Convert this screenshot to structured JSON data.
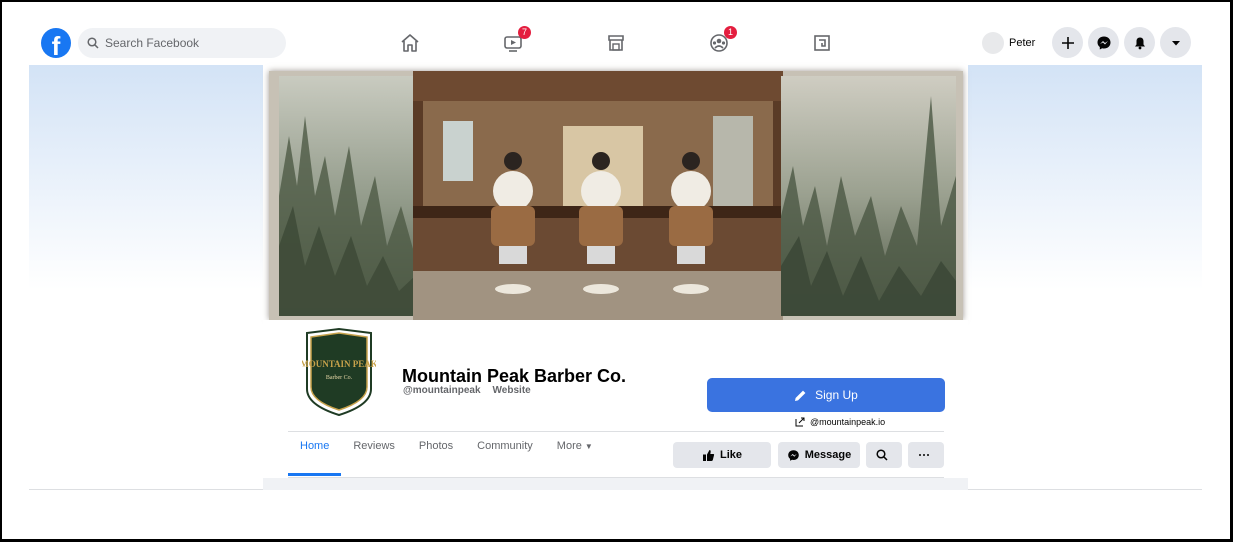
{
  "search": {
    "placeholder": "Search Facebook"
  },
  "nav": {
    "watch_badge": "7",
    "groups_badge": "1"
  },
  "user": {
    "name": "Peter"
  },
  "page": {
    "logo_text": "MOUNTAIN PEAK",
    "logo_subtext": "Barber Co.",
    "name": "Mountain Peak Barber Co.",
    "handle": "@mountainpeak",
    "website_label": "Website",
    "signup_label": "Sign Up",
    "website_link": "@mountainpeak.io"
  },
  "tabs": [
    "Home",
    "Reviews",
    "Photos",
    "Community",
    "More"
  ],
  "actions": {
    "like": "Like",
    "message": "Message"
  },
  "colors": {
    "brand": "#1877f2",
    "signup": "#3a73e0",
    "badge": "#e41e3f",
    "logo_green": "#1f3b24",
    "logo_gold": "#c7a24b"
  }
}
